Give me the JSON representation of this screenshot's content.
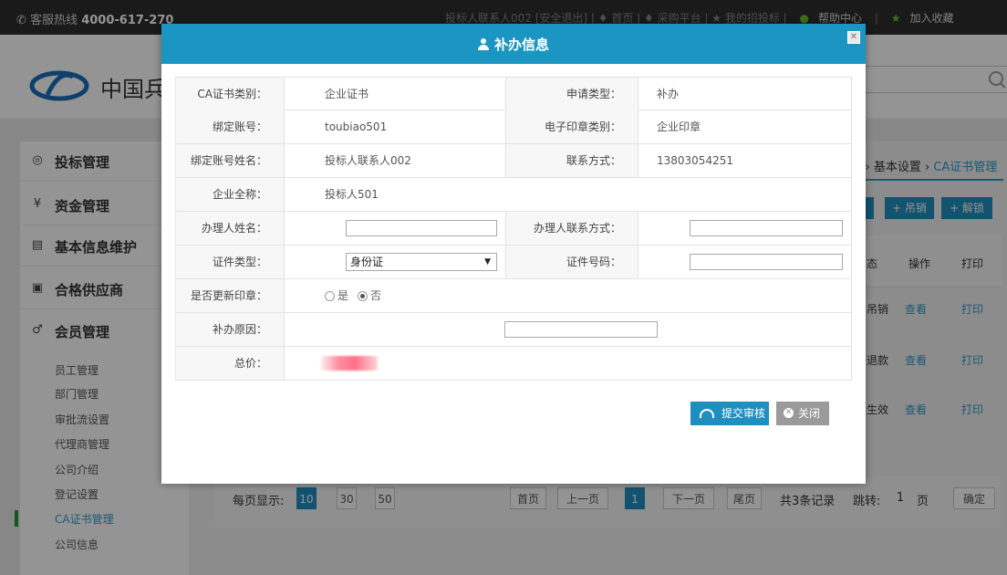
{
  "topbar": {
    "hotline_label": "客服热线",
    "hotline_number": "4000-617-270",
    "links_text": "投标人联系人002 [安全退出]  |  ♦ 首页  |  ♦ 采购平台  |  ★ 我的招投标  |",
    "help": "帮助中心",
    "fav": "加入收藏"
  },
  "header": {
    "site_name": "中国兵"
  },
  "sidebar": {
    "menus": [
      {
        "icon": "◎",
        "label": "投标管理"
      },
      {
        "icon": "¥",
        "label": "资金管理"
      },
      {
        "icon": "▤",
        "label": "基本信息维护"
      },
      {
        "icon": "▣",
        "label": "合格供应商"
      },
      {
        "icon": "♂",
        "label": "会员管理"
      }
    ],
    "submenu": [
      "员工管理",
      "部门管理",
      "审批流设置",
      "代理商管理",
      "公司介绍",
      "登记设置",
      "CA证书管理",
      "公司信息"
    ]
  },
  "main": {
    "breadcrumb_pre": ": › 基本设置 ›",
    "breadcrumb_cur": "CA证书管理",
    "btn_revoke": "+ 吊销",
    "btn_unlock": "+ 解锁",
    "table": {
      "headers": [
        "态",
        "操作",
        "打印"
      ],
      "rows": [
        {
          "status": "吊销",
          "op": "查看",
          "print": "打印"
        },
        {
          "status": "退款",
          "op": "查看",
          "print": "打印"
        },
        {
          "status": "生效",
          "op": "查看",
          "print": "打印"
        }
      ]
    },
    "pager": {
      "per_page_label": "每页显示:",
      "sizes": [
        "10",
        "30",
        "50"
      ],
      "first": "首页",
      "prev": "上一页",
      "current": "1",
      "next": "下一页",
      "last": "尾页",
      "total": "共3条记录",
      "jump_label": "跳转:",
      "jump_value": "1",
      "page_unit": "页",
      "confirm": "确定"
    }
  },
  "modal": {
    "title": "补办信息",
    "fields": {
      "ca_type_label": "CA证书类别：",
      "ca_type": "企业证书",
      "apply_type_label": "申请类型：",
      "apply_type": "补办",
      "account_label": "绑定账号：",
      "account": "toubiao501",
      "seal_type_label": "电子印章类别：",
      "seal_type": "企业印章",
      "account_name_label": "绑定账号姓名：",
      "account_name": "投标人联系人002",
      "contact_label": "联系方式：",
      "contact": "13803054251",
      "company_label": "企业全称：",
      "company": "投标人501",
      "handler_name_label": "办理人姓名：",
      "handler_contact_label": "办理人联系方式：",
      "id_type_label": "证件类型：",
      "id_type_value": "身份证",
      "id_no_label": "证件号码：",
      "renew_seal_label": "是否更新印章：",
      "renew_yes": "是",
      "renew_no": "否",
      "reason_label": "补办原因：",
      "total_label": "总价："
    },
    "submit": "提交审核",
    "close": "关闭"
  }
}
